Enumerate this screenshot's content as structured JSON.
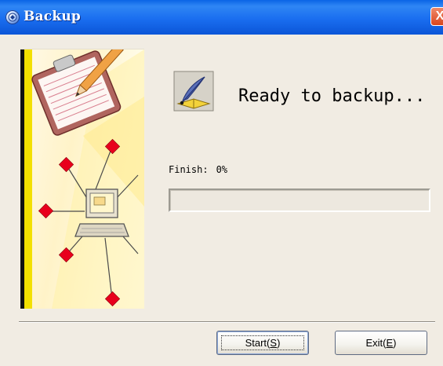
{
  "window": {
    "title": "Backup",
    "close_glyph": "X"
  },
  "icons": {
    "title_icon": "app-globe-icon",
    "close_icon": "close-icon",
    "backup_icon": "quill-document-icon",
    "illustration": "clipboard-computer-network-illustration"
  },
  "main": {
    "status": "Ready to backup...",
    "finish_label": "Finish:",
    "finish_value": "0%",
    "progress": 0
  },
  "buttons": {
    "start_text": "Start(",
    "start_key": "S",
    "start_end": ")",
    "exit_text": "Exit(",
    "exit_key": "E",
    "exit_end": ")"
  },
  "colors": {
    "titlebar": "#0b55d7",
    "window_bg": "#f1ece3",
    "accent_bar": "#f3e000",
    "diamond": "#e8001c"
  }
}
